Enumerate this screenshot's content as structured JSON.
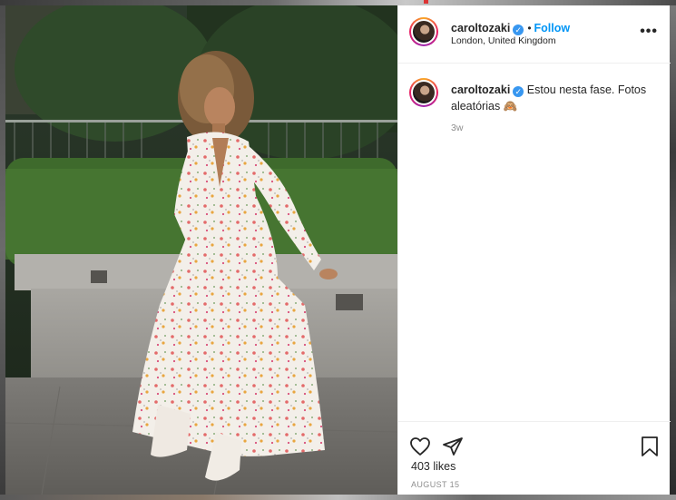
{
  "post": {
    "username": "caroltozaki",
    "follow_label": "Follow",
    "separator": "•",
    "location": "London, United Kingdom",
    "more_label": "•••",
    "caption": "Estou nesta fase. Fotos aleatórias 🙈",
    "time_ago": "3w",
    "likes": "403 likes",
    "date": "AUGUST 15"
  },
  "icons": {
    "header_avatar": "profile-avatar",
    "verified": "verified-badge-icon",
    "more": "more-options-icon",
    "like": "heart-icon",
    "share": "paper-plane-icon",
    "save": "bookmark-icon"
  },
  "colors": {
    "follow": "#0095f6",
    "verified": "#3897f0",
    "text": "#262626",
    "muted": "#8e8e8e"
  }
}
